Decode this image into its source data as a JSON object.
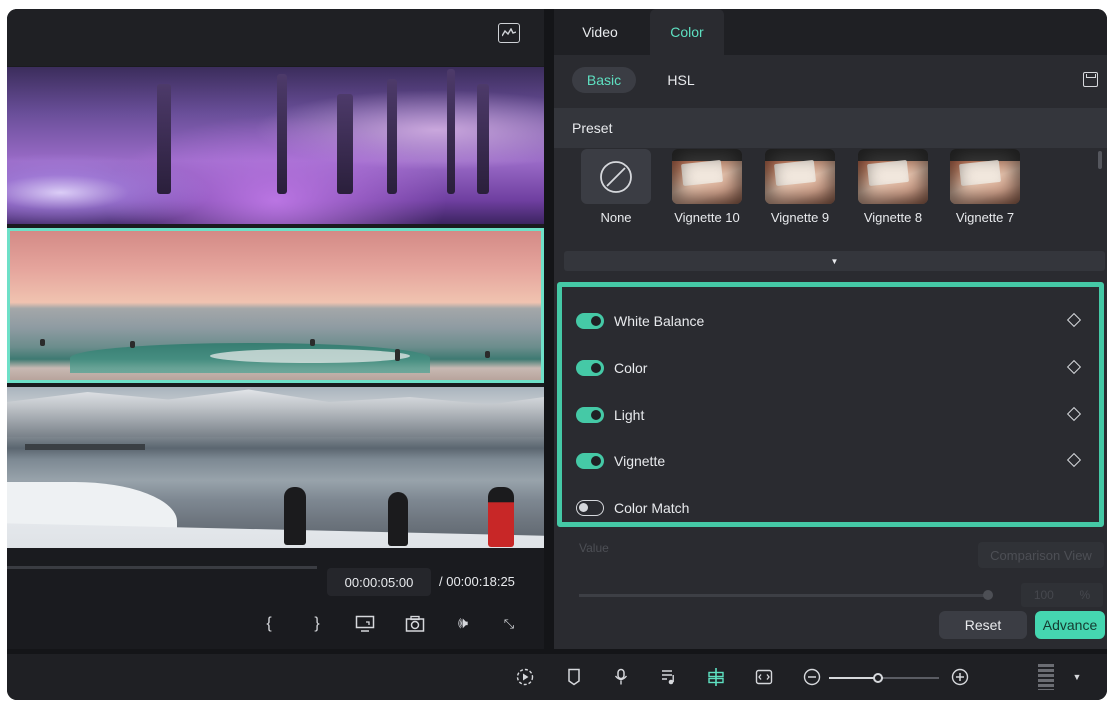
{
  "preview": {
    "current_time": "00:00:05:00",
    "total_time": "/ 00:00:18:25",
    "controls": {
      "mark_in": "{",
      "mark_out": "}",
      "volume": "🕪",
      "fullscreen": "⤡"
    }
  },
  "right_panel": {
    "tabs": [
      {
        "label": "Video"
      },
      {
        "label": "Color"
      }
    ],
    "active_tab": "Color",
    "subtabs": [
      {
        "label": "Basic"
      },
      {
        "label": "HSL"
      }
    ],
    "active_subtab": "Basic",
    "preset": {
      "header": "Preset",
      "items": [
        {
          "label": "None"
        },
        {
          "label": "Vignette 10"
        },
        {
          "label": "Vignette 9"
        },
        {
          "label": "Vignette 8"
        },
        {
          "label": "Vignette 7"
        }
      ]
    },
    "adjustments": [
      {
        "label": "White Balance",
        "enabled": true
      },
      {
        "label": "Color",
        "enabled": true
      },
      {
        "label": "Light",
        "enabled": true
      },
      {
        "label": "Vignette",
        "enabled": true
      },
      {
        "label": "Color Match",
        "enabled": false
      }
    ],
    "value_label": "Value",
    "comparison_button": "Comparison View",
    "value_field": "100",
    "value_unit": "%",
    "reset_button": "Reset",
    "advance_button": "Advance"
  },
  "colors": {
    "accent": "#45c9a6",
    "accent_text": "#5ee0c1",
    "panel_bg": "#2a2b30",
    "app_bg": "#141518"
  },
  "icons": {
    "preview_toolbar": [
      "screen-icon",
      "camera-icon",
      "volume-icon",
      "expand-icon"
    ],
    "bottom_toolbar": [
      "render-icon",
      "marker-icon",
      "microphone-icon",
      "music-list-icon",
      "split-icon",
      "fit-icon",
      "zoom-out-icon",
      "zoom-in-icon",
      "grid-icon",
      "chevron-down-icon"
    ]
  }
}
